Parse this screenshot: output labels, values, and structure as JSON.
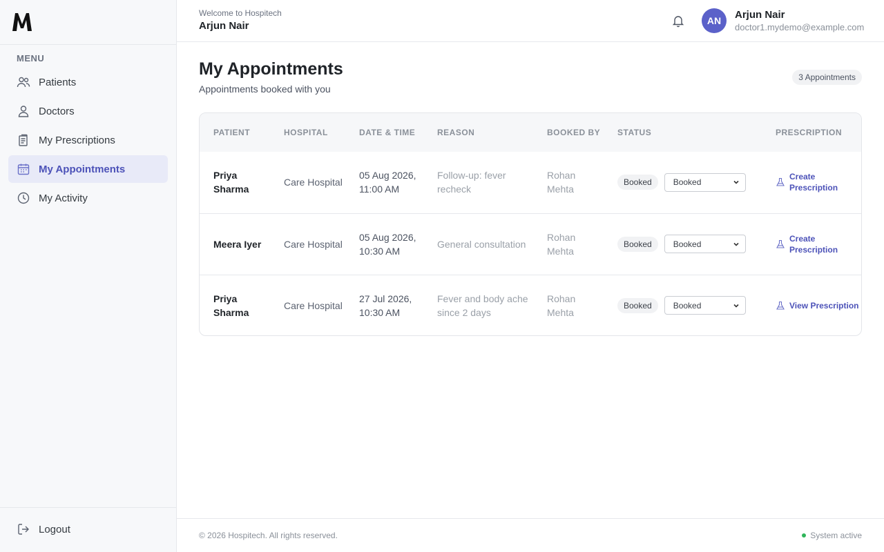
{
  "sidebar": {
    "menu_label": "MENU",
    "items": [
      {
        "label": "Patients",
        "icon": "users-icon"
      },
      {
        "label": "Doctors",
        "icon": "user-icon"
      },
      {
        "label": "My Prescriptions",
        "icon": "prescription-icon"
      },
      {
        "label": "My Appointments",
        "icon": "calendar-icon",
        "active": true
      },
      {
        "label": "My Activity",
        "icon": "clock-icon"
      }
    ],
    "logout_label": "Logout"
  },
  "header": {
    "welcome": "Welcome to Hospitech",
    "welcome_name": "Arjun Nair",
    "avatar_initials": "AN",
    "user_name": "Arjun Nair",
    "user_email": "doctor1.mydemo@example.com"
  },
  "main": {
    "title": "My Appointments",
    "subtitle": "Appointments booked with you",
    "count_badge": "3 Appointments",
    "columns": [
      "Patient",
      "Hospital",
      "Date & Time",
      "Reason",
      "Booked By",
      "Status",
      "Prescription"
    ],
    "rows": [
      {
        "patient": "Priya Sharma",
        "hospital": "Care Hospital",
        "datetime": "05 Aug 2026, 11:00 AM",
        "reason": "Follow-up: fever recheck",
        "booked_by": "Rohan Mehta",
        "status": "Booked",
        "status_select": "Booked",
        "prescription": "Create Prescription"
      },
      {
        "patient": "Meera Iyer",
        "hospital": "Care Hospital",
        "datetime": "05 Aug 2026, 10:30 AM",
        "reason": "General consultation",
        "booked_by": "Rohan Mehta",
        "status": "Booked",
        "status_select": "Booked",
        "prescription": "Create Prescription"
      },
      {
        "patient": "Priya Sharma",
        "hospital": "Care Hospital",
        "datetime": "27 Jul 2026, 10:30 AM",
        "reason": "Fever and body ache since 2 days",
        "booked_by": "Rohan Mehta",
        "status": "Booked",
        "status_select": "Booked",
        "prescription": "View Prescription"
      }
    ]
  },
  "footer": {
    "copyright": "© 2026 Hospitech. All rights reserved.",
    "system_status": "System active"
  },
  "colors": {
    "accent": "#5b61c9",
    "active_nav_bg": "#e8eaf8",
    "status_active": "#2fb55a"
  }
}
